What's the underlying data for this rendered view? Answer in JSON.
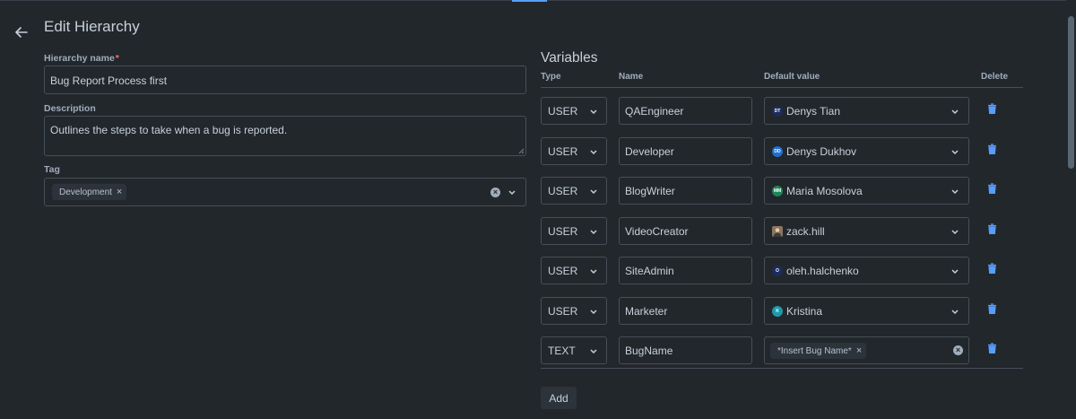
{
  "page": {
    "title": "Edit Hierarchy",
    "name_label": "Hierarchy name",
    "required_mark": "*",
    "name_value": "Bug Report Process first",
    "description_label": "Description",
    "description_value": "Outlines the steps to take when a bug is reported.",
    "tag_label": "Tag",
    "tag_chip": "Development"
  },
  "variables": {
    "title": "Variables",
    "columns": {
      "type": "Type",
      "name": "Name",
      "default": "Default value",
      "delete": "Delete"
    },
    "rows": [
      {
        "type": "USER",
        "name": "QAEngineer",
        "default": "Denys Tian",
        "initials": "DT",
        "avatar_color": "#1d2b5c"
      },
      {
        "type": "USER",
        "name": "Developer",
        "default": "Denys Dukhov",
        "initials": "DD",
        "avatar_color": "#1f6fd1"
      },
      {
        "type": "USER",
        "name": "BlogWriter",
        "default": "Maria Mosolova",
        "initials": "MM",
        "avatar_color": "#1f845a"
      },
      {
        "type": "USER",
        "name": "VideoCreator",
        "default": "zack.hill",
        "initials": "",
        "avatar_color": "#8a7560"
      },
      {
        "type": "USER",
        "name": "SiteAdmin",
        "default": "oleh.halchenko",
        "initials": "O",
        "avatar_color": "#1d2b5c"
      },
      {
        "type": "USER",
        "name": "Marketer",
        "default": "Kristina",
        "initials": "K",
        "avatar_color": "#1d9aaa"
      },
      {
        "type": "TEXT",
        "name": "BugName",
        "default": "*Insert Bug Name*"
      }
    ],
    "add_label": "Add"
  },
  "colors": {
    "background": "#22272b",
    "accent": "#579dff",
    "trash": "#579dff"
  }
}
